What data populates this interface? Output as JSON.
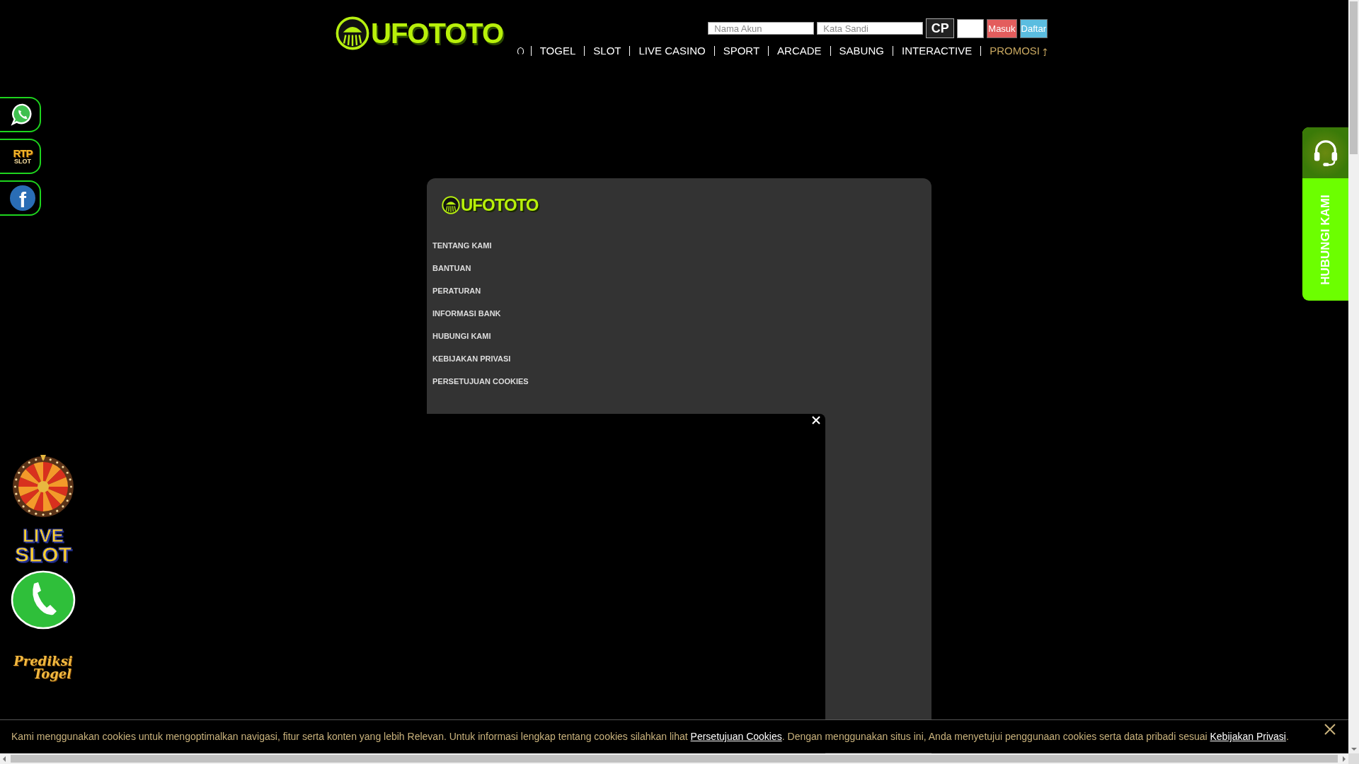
{
  "header": {
    "logo": "UFOTOTO",
    "login": {
      "username": {
        "placeholder": "Nama Akun"
      },
      "password": {
        "placeholder": "Kata Sandi"
      },
      "captcha_text": "CP",
      "buttons": [
        {
          "label": "Masuk",
          "kind": "login"
        },
        {
          "label": "Daftar",
          "kind": "register"
        }
      ]
    },
    "nav": [
      {
        "kind": "home"
      },
      {
        "kind": "link",
        "label": "TOGEL",
        "highlighted": false
      },
      {
        "kind": "link",
        "label": "SLOT",
        "highlighted": false
      },
      {
        "kind": "link",
        "label": "LIVE CASINO",
        "highlighted": false
      },
      {
        "kind": "link",
        "label": "SPORT",
        "highlighted": false
      },
      {
        "kind": "link",
        "label": "ARCADE",
        "highlighted": false
      },
      {
        "kind": "link",
        "label": "SABUNG",
        "highlighted": false
      },
      {
        "kind": "link",
        "label": "INTERACTIVE",
        "highlighted": false
      },
      {
        "kind": "link",
        "label": "PROMOSI",
        "highlighted": true
      },
      {
        "kind": "dropdown"
      }
    ]
  },
  "side_links": [
    {
      "kind": "whatsapp"
    },
    {
      "kind": "rtp",
      "label": "RTP",
      "sublabel": "SLOT"
    },
    {
      "kind": "facebook",
      "glyph": "f"
    }
  ],
  "side_promos": [
    {
      "kind": "wheel"
    },
    {
      "kind": "live_slot",
      "label": "LIVE",
      "sublabel": "SLOT"
    },
    {
      "kind": "phone"
    },
    {
      "kind": "prediksi",
      "label": "Prediksi",
      "sublabel": "Togel"
    }
  ],
  "contact_tab": {
    "label": "HUBUNGI KAMI"
  },
  "footer": {
    "logo": "UFOTOTO",
    "links": [
      "TENTANG KAMI",
      "BANTUAN",
      "PERATURAN",
      "INFORMASI BANK",
      "HUBUNGI KAMI",
      "KEBIJAKAN PRIVASI",
      "PERSETUJUAN COOKIES"
    ]
  },
  "cookie_notice": {
    "segments": [
      {
        "kind": "text",
        "text": "Kami menggunakan cookies untuk mengoptimalkan navigasi, fitur serta konten yang lebih Relevan. Untuk informasi lengkap tentang cookies silahkan lihat "
      },
      {
        "kind": "link",
        "text": "Persetujuan Cookies"
      },
      {
        "kind": "text",
        "text": ". Dengan menggunakan situs ini, Anda menyetujui penggunaan cookies serta data pribadi sesuai "
      },
      {
        "kind": "link",
        "text": "Kebijakan Privasi"
      },
      {
        "kind": "text",
        "text": "."
      }
    ]
  }
}
